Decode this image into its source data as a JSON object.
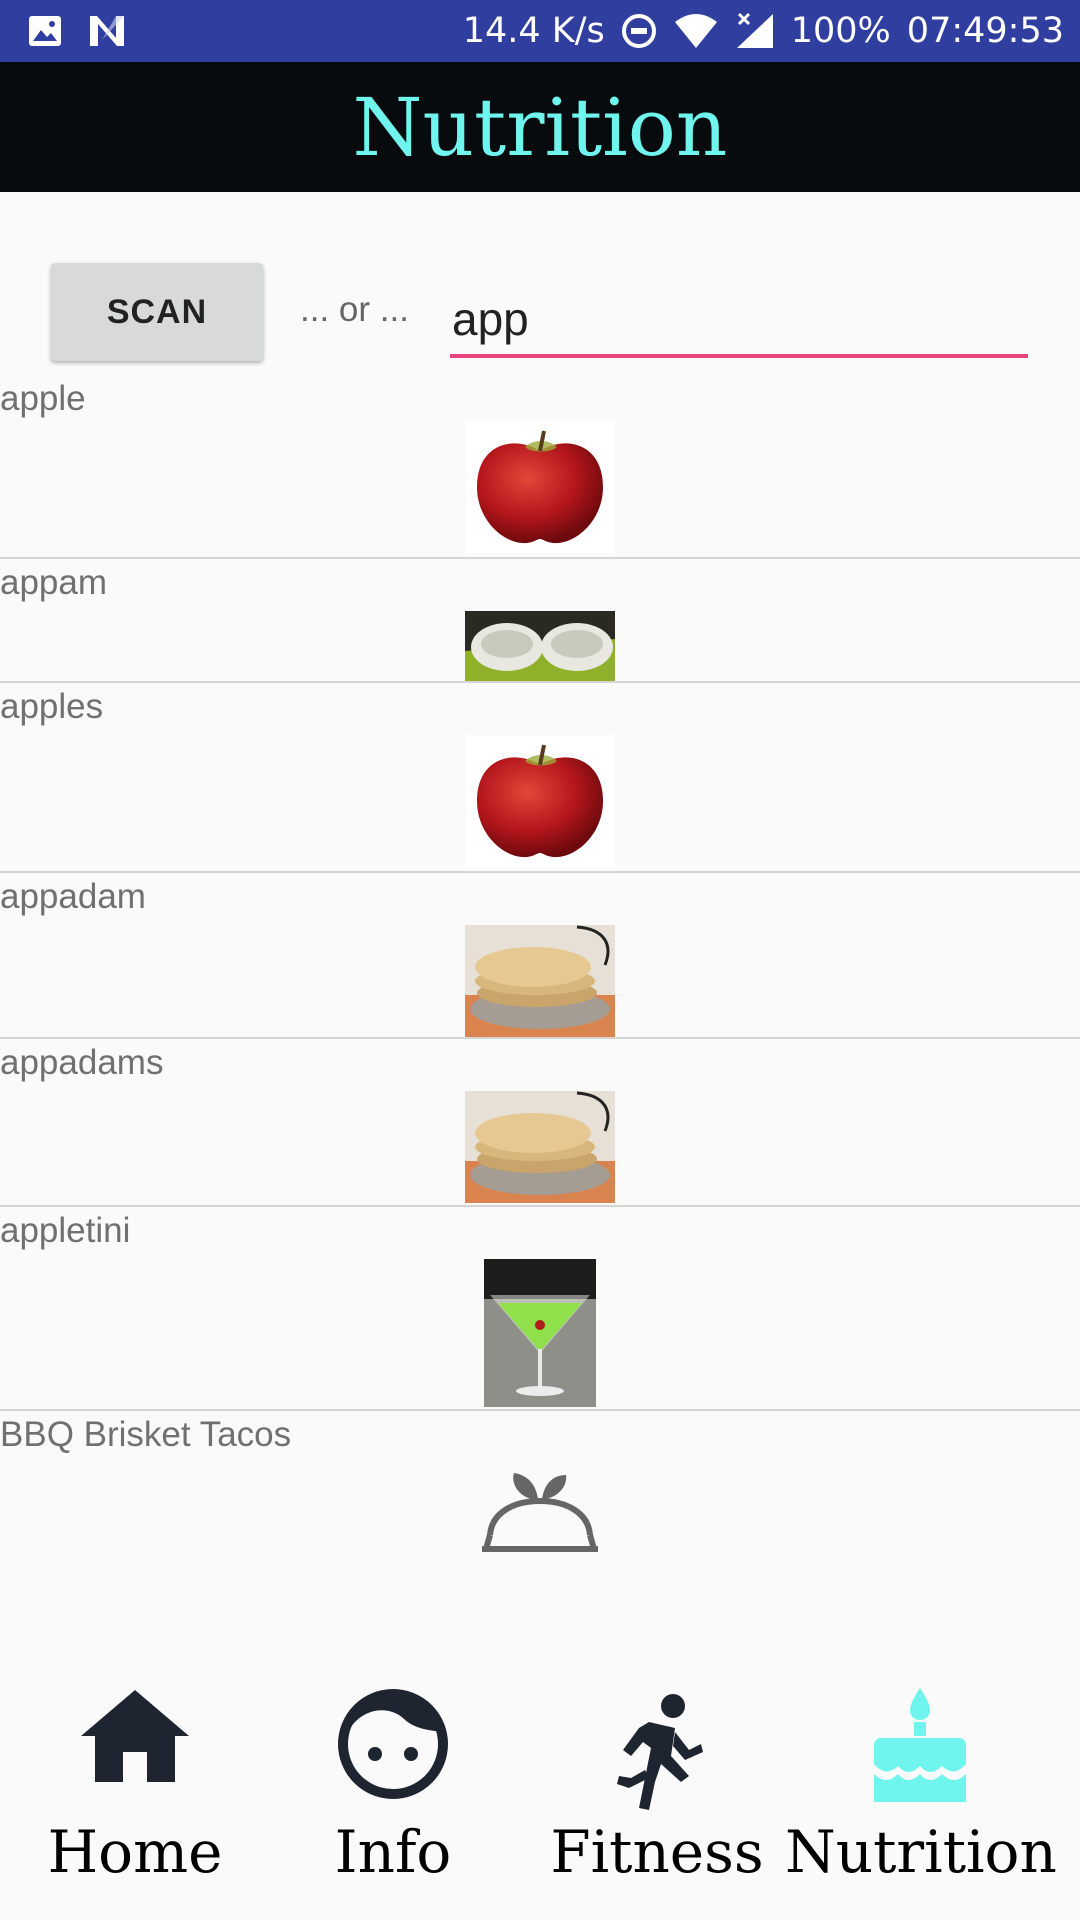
{
  "status_bar": {
    "speed": "14.4 K/s",
    "battery": "100%",
    "time": "07:49:53"
  },
  "header": {
    "title": "Nutrition"
  },
  "search": {
    "scan_label": "SCAN",
    "or_text": "... or ...",
    "query": "app"
  },
  "results": [
    {
      "name": "apple",
      "image": "apple-photo"
    },
    {
      "name": "appam",
      "image": "appam-photo"
    },
    {
      "name": "apples",
      "image": "apple-photo"
    },
    {
      "name": "appadam",
      "image": "papadum-photo"
    },
    {
      "name": "appadams",
      "image": "papadum-photo"
    },
    {
      "name": "appletini",
      "image": "appletini-photo"
    },
    {
      "name": "BBQ Brisket Tacos",
      "image": "food-bowl-icon"
    }
  ],
  "nav": {
    "items": [
      {
        "label": "Home",
        "icon": "home-icon"
      },
      {
        "label": "Info",
        "icon": "face-icon"
      },
      {
        "label": "Fitness",
        "icon": "runner-icon"
      },
      {
        "label": "Nutrition",
        "icon": "cake-icon"
      }
    ],
    "active_color": "#6ff5ee",
    "inactive_color": "#1e2530"
  },
  "colors": {
    "status_bar": "#303f9f",
    "title_bar": "#080b0d",
    "title_text": "#6ff5ee",
    "input_underline": "#e5457c"
  }
}
